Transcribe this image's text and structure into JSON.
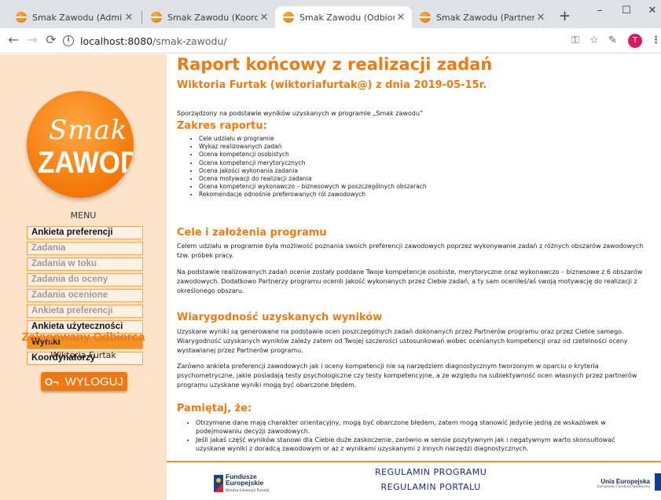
{
  "browser": {
    "tabs": [
      {
        "title": "Smak Zawodu (Administrator)",
        "active": false
      },
      {
        "title": "Smak Zawodu (Koordynator)",
        "active": false
      },
      {
        "title": "Smak Zawodu (Odbiorca)",
        "active": true
      },
      {
        "title": "Smak Zawodu (Partner)",
        "active": false
      }
    ],
    "tab_close": "✕",
    "new_tab": "+",
    "url_host": "localhost:8080",
    "url_path": "/smak-zawodu/",
    "profile_initial": "T",
    "window_controls": {
      "minimize": "–",
      "maximize": "☐",
      "close": "✕"
    }
  },
  "sidebar": {
    "logo_line1": "Smak",
    "logo_line2": "ZAWODU",
    "menu_title": "MENU",
    "menu_items": [
      {
        "label": "Ankieta preferencji",
        "state": "enabled"
      },
      {
        "label": "Zadania",
        "state": "disabled"
      },
      {
        "label": "Zadania w toku",
        "state": "disabled"
      },
      {
        "label": "Zadania do oceny",
        "state": "disabled"
      },
      {
        "label": "Zadania ocenione",
        "state": "disabled"
      },
      {
        "label": "Ankieta preferencji",
        "state": "disabled"
      },
      {
        "label": "Ankieta użyteczności",
        "state": "enabled"
      },
      {
        "label": "Wyniki",
        "state": "active"
      },
      {
        "label": "Koordynatorzy",
        "state": "enabled"
      }
    ],
    "logged_label": "Zalogowany Odbiorca",
    "user_name": "Wiktoria Furtak",
    "logout_label": "WYLOGUJ"
  },
  "report": {
    "title": "Raport końcowy z realizacji zadań",
    "subtitle": "Wiktoria Furtak (wiktoriafurtak@) z dnia 2019-05-15r.",
    "intro": "Sporządzony na podstawie wyników uzyskanych w programie „Smak zawodu”",
    "scope_heading": "Zakres raportu:",
    "scope_items": [
      "Cele udziału w programie",
      "Wykaz realizowanych zadań",
      "Ocena kompetencji osobistych",
      "Ocena kompetencji merytorycznych",
      "Ocena jakości wykonania zadania",
      "Ocena motywacji do realizacji zadania",
      "Ocena kompetencji wykonawczo – biznesowych w poszczególnych obszarach",
      "Rekomendacje odnośnie preferowanych ról zawodowych"
    ],
    "goals_heading": "Cele i założenia programu",
    "goals_p1": "Celem udziału w programie była możliwość poznania swoich preferencji zawodowych poprzez wykonywanie zadań z różnych obszarów zawodowych tzw. próbek pracy.",
    "goals_p2": "Na podstawie realizowanych zadań ocenie zostały poddane Twoje kompetencje osobiste, merytoryczne oraz wykonawczo – biznesowe z 6 obszarów zawodowych. Dodatkowo Partnerzy programu ocenili jakość wykonanych przez Ciebie zadań, a ty sam oceniłeś/aś swoją motywację do realizacji z określonego obszaru.",
    "reliability_heading": "Wiarygodność uzyskanych wyników",
    "reliability_p1": "Uzyskane wyniki są generowane na podstawie ocen poszczególnych zadań dokonanych przez Partnerów programu oraz przez Ciebie samego. Wiarygodność uzyskanych wyników zależy zatem od Twojej szczerości ustosunkowań wobec ocenianych kompetencji oraz od rzetelności oceny wystawianej przez Partnerów programu.",
    "reliability_p2": "Zarówno ankieta preferencji zawodowych jak i oceny kompetencji nie są narzędziem diagnostycznym tworzonym w oparciu o kryteria psychometryczne, jakie posiadają testy psychologiczne czy testy kompetencyjne, a ze względu na subiektywność ocen własnych przez partnerów programu uzyskane wyniki mogą być obarczone błędem.",
    "remember_heading": "Pamiętaj, że:",
    "remember_items": [
      "Otrzymane dane mają charakter orientacyjny, mogą być obarczone błędem, zatem mogą stanowić jedynie jedną ze wskazówek w podejmowaniu decyzji zawodowych.",
      "Jeśli jakaś część wyników stanowi dla Ciebie duże zaskoczenie, zarówno w sensie pozytywnym jak i negatywnym warto skonsultować uzyskane wyniki z doradcą zawodowym or az z wynikami uzyskanymi z innych narzędzi diagnostycznych."
    ]
  },
  "footer": {
    "fe_line1": "Fundusze",
    "fe_line2": "Europejskie",
    "fe_sub": "Wiedza Edukacja Rozwój",
    "link1": "REGULAMIN PROGRAMU",
    "link2": "REGULAMIN PORTALU",
    "ue_title": "Unia Europejska",
    "ue_sub": "Europejski Fundusz Społeczny"
  }
}
